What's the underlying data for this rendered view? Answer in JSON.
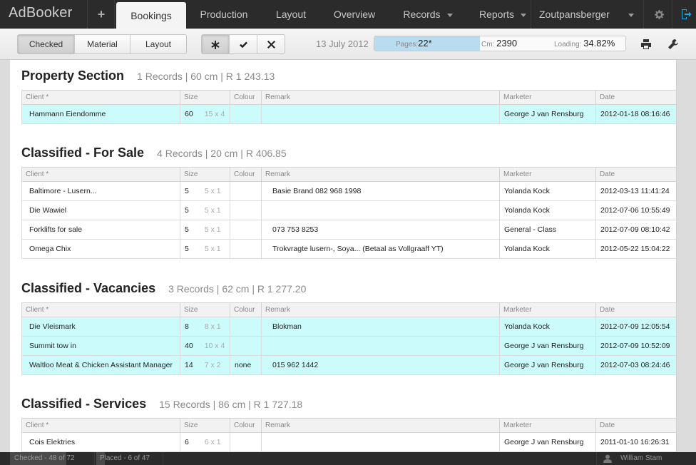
{
  "app": {
    "title": "AdBooker",
    "plus_label": "+"
  },
  "nav": {
    "active": "Bookings",
    "tabs": [
      {
        "label": "Bookings"
      },
      {
        "label": "Production"
      },
      {
        "label": "Layout"
      },
      {
        "label": "Overview"
      },
      {
        "label": "Records"
      },
      {
        "label": "Reports"
      },
      {
        "label": "Zoutpansberger"
      }
    ]
  },
  "toolbar": {
    "view_buttons": [
      "Checked",
      "Material",
      "Layout"
    ],
    "active_view": "Checked",
    "filter_icons": [
      "asterisk-icon",
      "check-icon",
      "cross-icon"
    ],
    "date": "13 July 2012",
    "stats": {
      "pages_label": "Pages:",
      "pages_value": "22*",
      "cm_label": "Cm:",
      "cm_value": "2390",
      "loading_label": "Loading:",
      "loading_value": "34.82%",
      "loading_fraction": 0.4218
    },
    "print_icon": "print-icon",
    "settings_icon": "wrench-icon"
  },
  "columns": [
    "Client *",
    "Size",
    "Colour",
    "Remark",
    "Marketer",
    "Date"
  ],
  "sections": [
    {
      "title": "Property Section",
      "meta": "1 Records | 60 cm | R 1 243.13",
      "rows": [
        {
          "client": "Hammann Eiendomme",
          "size": "60",
          "dims": "15 x 4",
          "colour": "",
          "remark": "",
          "marketer": "George J van Rensburg",
          "date": "2012-01-18 08:16:46",
          "highlight": true
        }
      ]
    },
    {
      "title": "Classified - For Sale",
      "meta": "4 Records | 20 cm | R 406.85",
      "rows": [
        {
          "client": "Baltimore - Lusern...",
          "size": "5",
          "dims": "5 x 1",
          "colour": "",
          "remark": "Basie Brand 082 968 1998",
          "marketer": "Yolanda Kock",
          "date": "2012-03-13 11:41:24",
          "highlight": false
        },
        {
          "client": "Die Wawiel",
          "size": "5",
          "dims": "5 x 1",
          "colour": "",
          "remark": "",
          "marketer": "Yolanda Kock",
          "date": "2012-07-06 10:55:49",
          "highlight": false
        },
        {
          "client": "Forklifts for sale",
          "size": "5",
          "dims": "5 x 1",
          "colour": "",
          "remark": "073 753 8253",
          "marketer": "General - Class",
          "date": "2012-07-09 08:10:42",
          "highlight": false
        },
        {
          "client": "Omega Chix",
          "size": "5",
          "dims": "5 x 1",
          "colour": "",
          "remark": "Trokvragte lusern-, Soya... (Betaal as Vollgraaff YT)",
          "marketer": "Yolanda Kock",
          "date": "2012-05-22 15:04:22",
          "highlight": false
        }
      ]
    },
    {
      "title": "Classified - Vacancies",
      "meta": "3 Records | 62 cm | R 1 277.20",
      "rows": [
        {
          "client": "Die Vleismark",
          "size": "8",
          "dims": "8 x 1",
          "colour": "",
          "remark": "Blokman",
          "marketer": "Yolanda Kock",
          "date": "2012-07-09 12:05:54",
          "highlight": true
        },
        {
          "client": "Summit tow in",
          "size": "40",
          "dims": "10 x 4",
          "colour": "",
          "remark": "",
          "marketer": "George J van Rensburg",
          "date": "2012-07-09 10:52:09",
          "highlight": true
        },
        {
          "client": "Waltloo Meat & Chicken Assistant Manager",
          "size": "14",
          "dims": "7 x 2",
          "colour": "none",
          "remark": "015 962 1442",
          "marketer": "George J van Rensburg",
          "date": "2012-07-03 08:24:46",
          "highlight": true
        }
      ]
    },
    {
      "title": "Classified - Services",
      "meta": "15 Records | 86 cm | R 1 727.18",
      "rows": [
        {
          "client": "Cois Elektries",
          "size": "6",
          "dims": "6 x 1",
          "colour": "",
          "remark": "",
          "marketer": "George J van Rensburg",
          "date": "2011-01-10 16:26:31",
          "highlight": false
        }
      ]
    }
  ],
  "statusbar": {
    "checked_label": "Checked -",
    "checked_count": "48",
    "checked_total": "of 72",
    "checked_fraction": 0.6667,
    "placed_label": "Placed -",
    "placed_count": "6 of 47",
    "placed_fraction": 0.1277,
    "user": "William Stam",
    "user_icon": "user-icon"
  },
  "colors": {
    "highlight": "#ccfbfb",
    "nav_bg": "#2b2b2b",
    "logout_icon": "#1fa8d8"
  }
}
